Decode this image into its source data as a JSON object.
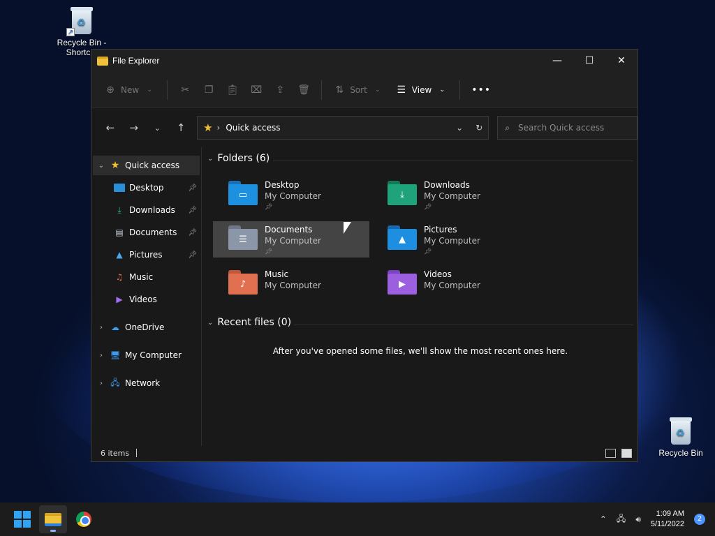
{
  "desktop": {
    "icons": [
      {
        "label": "Recycle Bin - Shortcut"
      },
      {
        "label": "Recycle Bin"
      }
    ]
  },
  "window": {
    "title": "File Explorer",
    "controls": {
      "minimize": "—",
      "maximize": "☐",
      "close": "✕"
    }
  },
  "toolbar": {
    "new_label": "New",
    "sort_label": "Sort",
    "view_label": "View",
    "more_label": "•••"
  },
  "nav": {
    "address": "Quick access",
    "search_placeholder": "Search Quick access"
  },
  "sidebar": {
    "quick_access": "Quick access",
    "items": [
      {
        "label": "Desktop",
        "icon": "desktop-icon",
        "pinned": true
      },
      {
        "label": "Downloads",
        "icon": "download-icon",
        "pinned": true
      },
      {
        "label": "Documents",
        "icon": "document-icon",
        "pinned": true
      },
      {
        "label": "Pictures",
        "icon": "picture-icon",
        "pinned": true
      },
      {
        "label": "Music",
        "icon": "music-icon",
        "pinned": false
      },
      {
        "label": "Videos",
        "icon": "video-icon",
        "pinned": false
      }
    ],
    "onedrive": "OneDrive",
    "my_computer": "My Computer",
    "network": "Network"
  },
  "main": {
    "folders_header": "Folders (6)",
    "folders": [
      {
        "name": "Desktop",
        "location": "My Computer",
        "pinned": true,
        "color": "#1e90e0"
      },
      {
        "name": "Downloads",
        "location": "My Computer",
        "pinned": true,
        "color": "#1fa37a"
      },
      {
        "name": "Documents",
        "location": "My Computer",
        "pinned": true,
        "color": "#8b96a8"
      },
      {
        "name": "Pictures",
        "location": "My Computer",
        "pinned": true,
        "color": "#1e8fe0"
      },
      {
        "name": "Music",
        "location": "My Computer",
        "pinned": false,
        "color": "#e07050"
      },
      {
        "name": "Videos",
        "location": "My Computer",
        "pinned": false,
        "color": "#9b5fe0"
      }
    ],
    "recent_header": "Recent files (0)",
    "recent_empty": "After you've opened some files, we'll show the most recent ones here."
  },
  "status": {
    "items_count": "6 items"
  },
  "taskbar": {
    "time": "1:09 AM",
    "date": "5/11/2022",
    "notifications": "2"
  }
}
